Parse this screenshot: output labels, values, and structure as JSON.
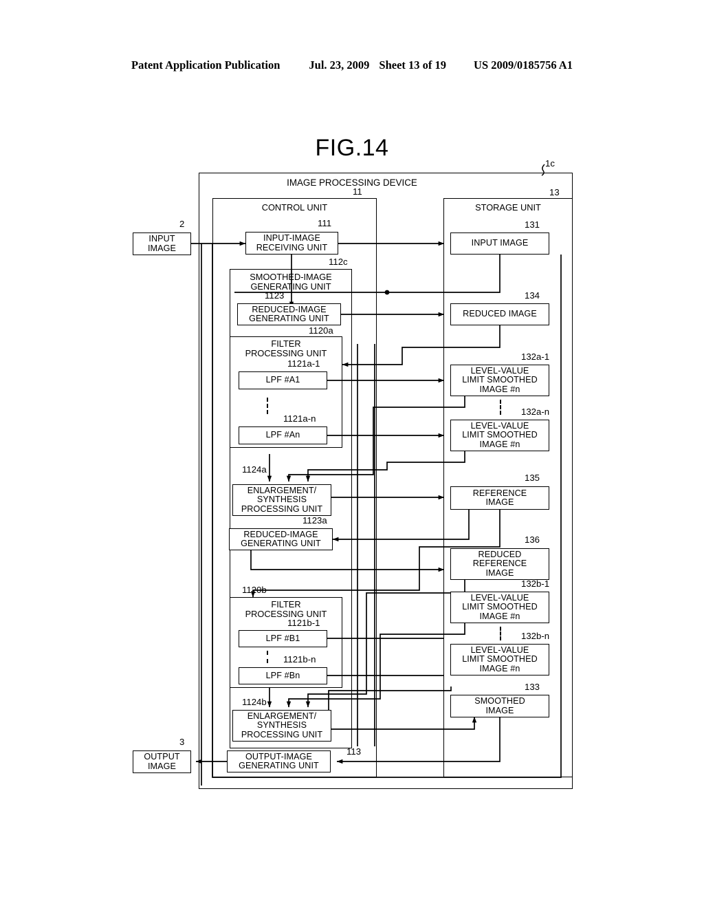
{
  "page_header": {
    "publication": "Patent Application Publication",
    "date": "Jul. 23, 2009",
    "sheet": "Sheet 13 of 19",
    "patent_number": "US 2009/0185756 A1"
  },
  "figure": {
    "title": "FIG.14",
    "device_label": "IMAGE PROCESSING DEVICE",
    "device_ref": "1c"
  },
  "external": {
    "input_image": {
      "label": "INPUT\nIMAGE",
      "ref": "2"
    },
    "output_image": {
      "label": "OUTPUT\nIMAGE",
      "ref": "3"
    }
  },
  "control_unit": {
    "title": "CONTROL UNIT",
    "ref": "11",
    "blocks": {
      "input_receiving": {
        "label": "INPUT-IMAGE\nRECEIVING UNIT",
        "ref": "111"
      },
      "smoothed_generating": {
        "label": "SMOOTHED-IMAGE\nGENERATING UNIT",
        "ref": "112c"
      },
      "reduced_generating_1": {
        "label": "REDUCED-IMAGE\nGENERATING UNIT",
        "ref": "1123"
      },
      "filter_unit_a": {
        "label": "FILTER\nPROCESSING UNIT",
        "ref": "1120a"
      },
      "lpf_a1": {
        "label": "LPF #A1",
        "ref": "1121a-1"
      },
      "lpf_an": {
        "label": "LPF #An",
        "ref": "1121a-n"
      },
      "enlargement_a": {
        "label": "ENLARGEMENT/\nSYNTHESIS\nPROCESSING UNIT",
        "ref": "1124a"
      },
      "reduced_generating_2": {
        "label": "REDUCED-IMAGE\nGENERATING UNIT",
        "ref": "1123a"
      },
      "filter_unit_b": {
        "label": "FILTER\nPROCESSING UNIT",
        "ref": "1120b"
      },
      "lpf_b1": {
        "label": "LPF #B1",
        "ref": "1121b-1"
      },
      "lpf_bn": {
        "label": "LPF #Bn",
        "ref": "1121b-n"
      },
      "enlargement_b": {
        "label": "ENLARGEMENT/\nSYNTHESIS\nPROCESSING UNIT",
        "ref": "1124b"
      },
      "output_generating": {
        "label": "OUTPUT-IMAGE\nGENERATING UNIT",
        "ref": "113"
      }
    }
  },
  "storage_unit": {
    "title": "STORAGE UNIT",
    "ref": "13",
    "blocks": {
      "input_image": {
        "label": "INPUT IMAGE",
        "ref": "131"
      },
      "reduced_image": {
        "label": "REDUCED IMAGE",
        "ref": "134"
      },
      "level_a1": {
        "label": "LEVEL-VALUE\nLIMIT SMOOTHED\nIMAGE #n",
        "ref": "132a-1"
      },
      "level_an": {
        "label": "LEVEL-VALUE\nLIMIT SMOOTHED\nIMAGE #n",
        "ref": "132a-n"
      },
      "reference_image": {
        "label": "REFERENCE\nIMAGE",
        "ref": "135"
      },
      "reduced_reference_image": {
        "label": "REDUCED\nREFERENCE\nIMAGE",
        "ref": "136"
      },
      "level_b1": {
        "label": "LEVEL-VALUE\nLIMIT SMOOTHED\nIMAGE #n",
        "ref": "132b-1"
      },
      "level_bn": {
        "label": "LEVEL-VALUE\nLIMIT SMOOTHED\nIMAGE #n",
        "ref": "132b-n"
      },
      "smoothed_image": {
        "label": "SMOOTHED\nIMAGE",
        "ref": "133"
      }
    }
  },
  "colors": {
    "line": "#000000",
    "background": "#ffffff"
  }
}
